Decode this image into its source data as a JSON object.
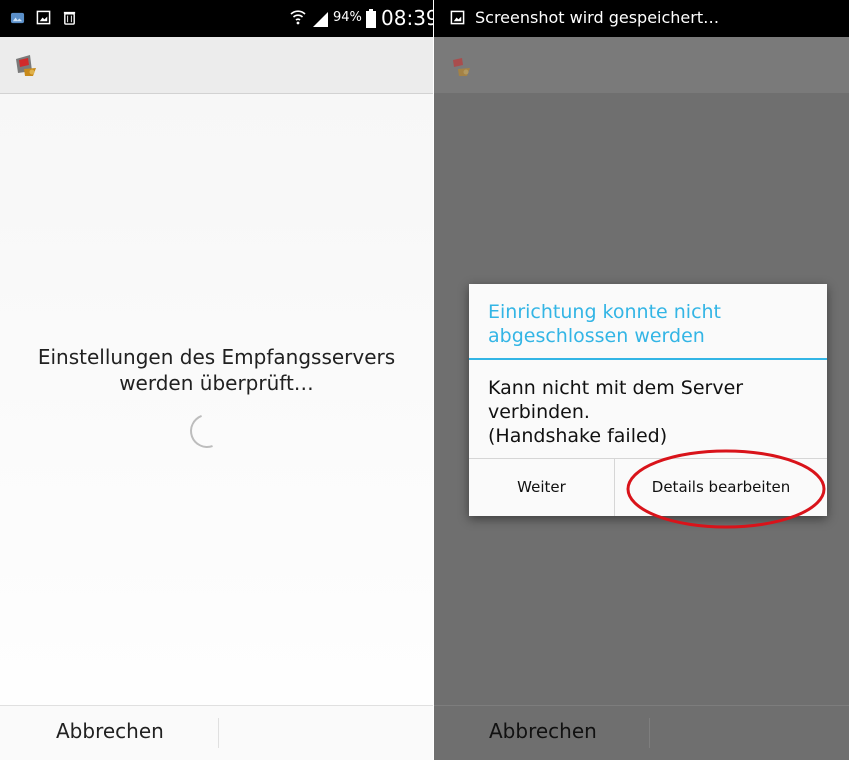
{
  "left": {
    "status_bar": {
      "battery": "94%",
      "time": "08:39"
    },
    "progress_message": "Einstellungen des Empfangsservers werden überprüft…",
    "cancel_button": "Abbrechen"
  },
  "right": {
    "status_bar": {
      "notification": "Screenshot wird gespeichert…"
    },
    "dialog": {
      "title": "Einrichtung konnte nicht abgeschlossen werden",
      "message_line1": "Kann nicht mit dem Server",
      "message_line2": "verbinden.",
      "message_line3": "(Handshake failed)",
      "button_continue": "Weiter",
      "button_edit": "Details bearbeiten"
    },
    "cancel_button": "Abbrechen"
  },
  "icons": {
    "status_left": [
      "gallery-icon",
      "screenshot-icon",
      "trash-icon"
    ],
    "status_right": [
      "wifi-icon",
      "signal-icon",
      "battery-icon"
    ],
    "app": "email-app-icon"
  },
  "colors": {
    "accent": "#33b5e5",
    "highlight": "#d9131a"
  }
}
